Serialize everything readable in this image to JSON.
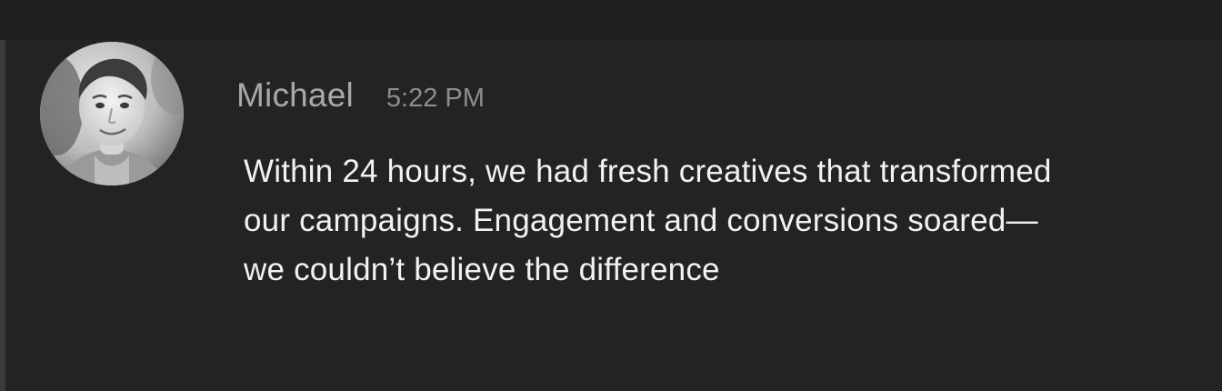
{
  "message": {
    "author": "Michael",
    "timestamp": "5:22 PM",
    "lines": [
      "Within 24 hours, we had fresh creatives that transformed",
      "our campaigns. Engagement and conversions soared—",
      "we couldn’t believe the difference"
    ]
  },
  "icons": {
    "avatar": "user-avatar-photo"
  },
  "colors": {
    "background": "#232323",
    "author": "#a8a8a8",
    "timestamp": "#8e8e8e",
    "text": "#f2f2f2"
  }
}
